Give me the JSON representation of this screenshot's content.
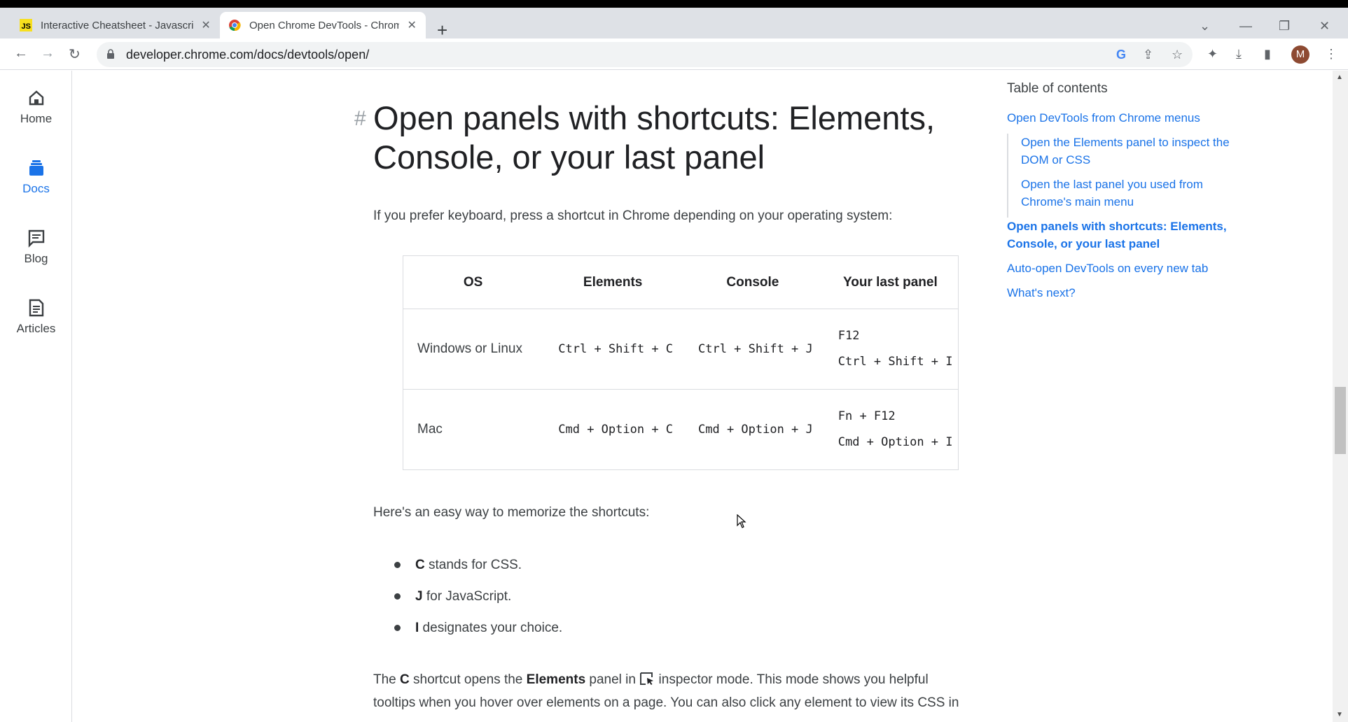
{
  "browser": {
    "tabs": [
      {
        "title": "Interactive Cheatsheet - Javascript",
        "favicon": "js-icon",
        "active": false
      },
      {
        "title": "Open Chrome DevTools - Chrome Developers",
        "favicon": "chrome-icon",
        "active": true
      }
    ],
    "new_tab": "+",
    "url": "developer.chrome.com/docs/devtools/open/",
    "profile_initial": "M"
  },
  "leftnav": {
    "items": [
      {
        "label": "Home",
        "icon": "home-icon"
      },
      {
        "label": "Docs",
        "icon": "docs-icon",
        "active": true
      },
      {
        "label": "Blog",
        "icon": "blog-icon"
      },
      {
        "label": "Articles",
        "icon": "articles-icon"
      }
    ]
  },
  "article": {
    "anchor": "#",
    "heading": "Open panels with shortcuts: Elements, Console, or your last panel",
    "intro": "If you prefer keyboard, press a shortcut in Chrome depending on your operating system:",
    "table": {
      "headers": [
        "OS",
        "Elements",
        "Console",
        "Your last panel"
      ],
      "rows": [
        {
          "os": "Windows or Linux",
          "elements": "Ctrl + Shift + C",
          "console": "Ctrl + Shift + J",
          "last1": "F12",
          "last2": "Ctrl + Shift + I"
        },
        {
          "os": "Mac",
          "elements": "Cmd + Option + C",
          "console": "Cmd + Option + J",
          "last1": "Fn + F12",
          "last2": "Cmd + Option + I"
        }
      ]
    },
    "memorize": "Here's an easy way to memorize the shortcuts:",
    "bullets": [
      {
        "key": "C",
        "text": " stands for CSS."
      },
      {
        "key": "J",
        "text": " for JavaScript."
      },
      {
        "key": "I",
        "text": " designates your choice."
      }
    ],
    "final": {
      "p1": "The ",
      "k1": "C",
      "p2": " shortcut opens the ",
      "k2": "Elements",
      "p3": " panel in ",
      "p4": " inspector mode. This mode shows you helpful",
      "line2": "tooltips when you hover over elements on a page. You can also click any element to view its CSS in"
    }
  },
  "toc": {
    "title": "Table of contents",
    "items": [
      "Open DevTools from Chrome menus",
      "Open the Elements panel to inspect the DOM or CSS",
      "Open the last panel you used from Chrome's main menu",
      "Open panels with shortcuts: Elements, Console, or your last panel",
      "Auto-open DevTools on every new tab",
      "What's next?"
    ]
  },
  "colors": {
    "link": "#1a73e8",
    "text": "#3c4043",
    "tabstrip": "#dee1e6"
  }
}
